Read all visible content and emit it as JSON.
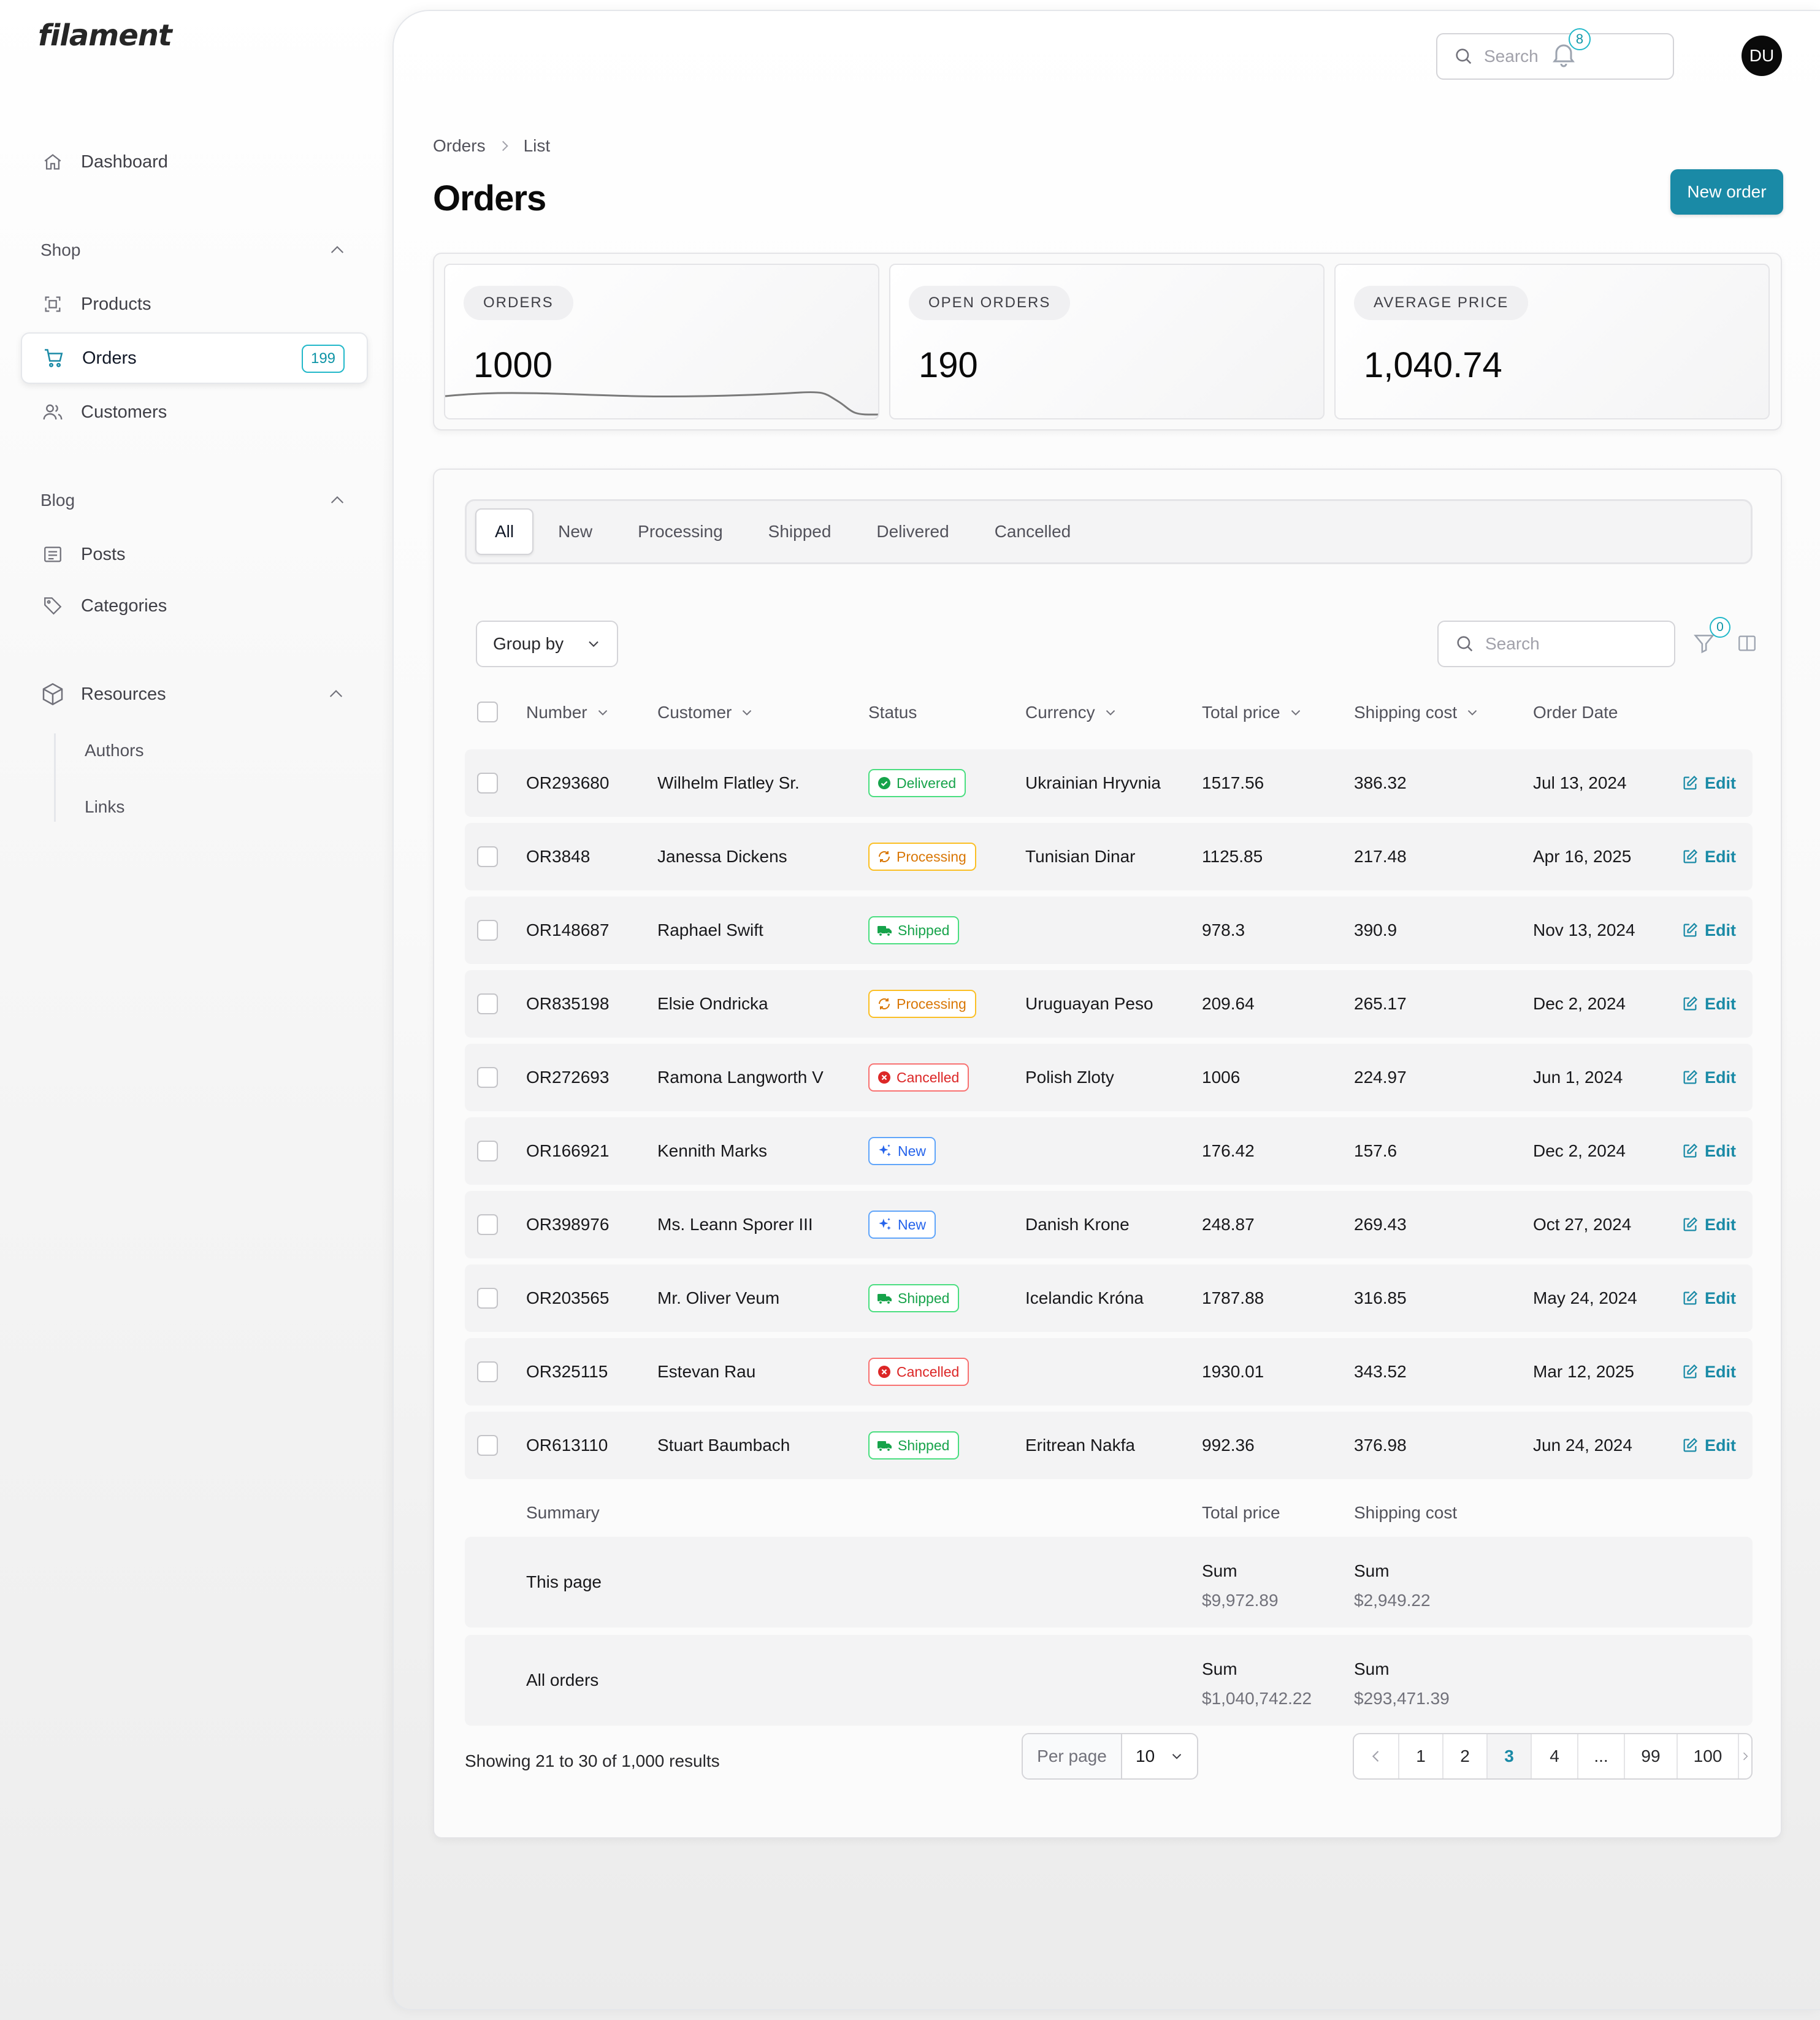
{
  "app": {
    "logo": "filament"
  },
  "sidebar": {
    "dashboard": "Dashboard",
    "groups": {
      "shop": "Shop",
      "blog": "Blog",
      "resources": "Resources"
    },
    "items": {
      "products": "Products",
      "orders": "Orders",
      "orders_badge": "199",
      "customers": "Customers",
      "posts": "Posts",
      "categories": "Categories",
      "authors": "Authors",
      "links": "Links"
    }
  },
  "topbar": {
    "search_placeholder": "Search",
    "notifications_count": "8",
    "avatar_initials": "DU"
  },
  "breadcrumb": {
    "parent": "Orders",
    "current": "List"
  },
  "page": {
    "title": "Orders",
    "new_button": "New order"
  },
  "stats": [
    {
      "label": "ORDERS",
      "value": "1000"
    },
    {
      "label": "OPEN ORDERS",
      "value": "190"
    },
    {
      "label": "AVERAGE PRICE",
      "value": "1,040.74"
    }
  ],
  "tabs": [
    "All",
    "New",
    "Processing",
    "Shipped",
    "Delivered",
    "Cancelled"
  ],
  "active_tab": "All",
  "toolbar": {
    "group_by": "Group by",
    "search_placeholder": "Search",
    "filter_count": "0"
  },
  "columns": {
    "number": "Number",
    "customer": "Customer",
    "status": "Status",
    "currency": "Currency",
    "total_price": "Total price",
    "shipping_cost": "Shipping cost",
    "order_date": "Order Date"
  },
  "rows": [
    {
      "number": "OR293680",
      "customer": "Wilhelm Flatley Sr.",
      "status": "Delivered",
      "currency": "Ukrainian Hryvnia",
      "total": "1517.56",
      "shipping": "386.32",
      "date": "Jul 13, 2024",
      "action": "Edit"
    },
    {
      "number": "OR3848",
      "customer": "Janessa Dickens",
      "status": "Processing",
      "currency": "Tunisian Dinar",
      "total": "1125.85",
      "shipping": "217.48",
      "date": "Apr 16, 2025",
      "action": "Edit"
    },
    {
      "number": "OR148687",
      "customer": "Raphael Swift",
      "status": "Shipped",
      "currency": "",
      "total": "978.3",
      "shipping": "390.9",
      "date": "Nov 13, 2024",
      "action": "Edit"
    },
    {
      "number": "OR835198",
      "customer": "Elsie Ondricka",
      "status": "Processing",
      "currency": "Uruguayan Peso",
      "total": "209.64",
      "shipping": "265.17",
      "date": "Dec 2, 2024",
      "action": "Edit"
    },
    {
      "number": "OR272693",
      "customer": "Ramona Langworth V",
      "status": "Cancelled",
      "currency": "Polish Zloty",
      "total": "1006",
      "shipping": "224.97",
      "date": "Jun 1, 2024",
      "action": "Edit"
    },
    {
      "number": "OR166921",
      "customer": "Kennith Marks",
      "status": "New",
      "currency": "",
      "total": "176.42",
      "shipping": "157.6",
      "date": "Dec 2, 2024",
      "action": "Edit"
    },
    {
      "number": "OR398976",
      "customer": "Ms. Leann Sporer III",
      "status": "New",
      "currency": "Danish Krone",
      "total": "248.87",
      "shipping": "269.43",
      "date": "Oct 27, 2024",
      "action": "Edit"
    },
    {
      "number": "OR203565",
      "customer": "Mr. Oliver Veum",
      "status": "Shipped",
      "currency": "Icelandic Króna",
      "total": "1787.88",
      "shipping": "316.85",
      "date": "May 24, 2024",
      "action": "Edit"
    },
    {
      "number": "OR325115",
      "customer": "Estevan Rau",
      "status": "Cancelled",
      "currency": "",
      "total": "1930.01",
      "shipping": "343.52",
      "date": "Mar 12, 2025",
      "action": "Edit"
    },
    {
      "number": "OR613110",
      "customer": "Stuart Baumbach",
      "status": "Shipped",
      "currency": "Eritrean Nakfa",
      "total": "992.36",
      "shipping": "376.98",
      "date": "Jun 24, 2024",
      "action": "Edit"
    }
  ],
  "summary": {
    "label": "Summary",
    "total_col": "Total price",
    "shipping_col": "Shipping cost",
    "this_page": {
      "label": "This page",
      "total_label": "Sum",
      "total": "$9,972.89",
      "shipping_label": "Sum",
      "shipping": "$2,949.22"
    },
    "all": {
      "label": "All orders",
      "total_label": "Sum",
      "total": "$1,040,742.22",
      "shipping_label": "Sum",
      "shipping": "$293,471.39"
    }
  },
  "pagination": {
    "info": "Showing 21 to 30 of 1,000 results",
    "per_page_label": "Per page",
    "per_page_value": "10",
    "pages": [
      "1",
      "2",
      "3",
      "4",
      "...",
      "99",
      "100"
    ],
    "current": "3"
  },
  "colors": {
    "primary": "#1a8aa6",
    "badge_outline": "#22b8c9",
    "delivered": "#16a34a",
    "processing": "#d97706",
    "shipped": "#16a34a",
    "cancelled": "#dc2626",
    "new": "#2563eb"
  }
}
